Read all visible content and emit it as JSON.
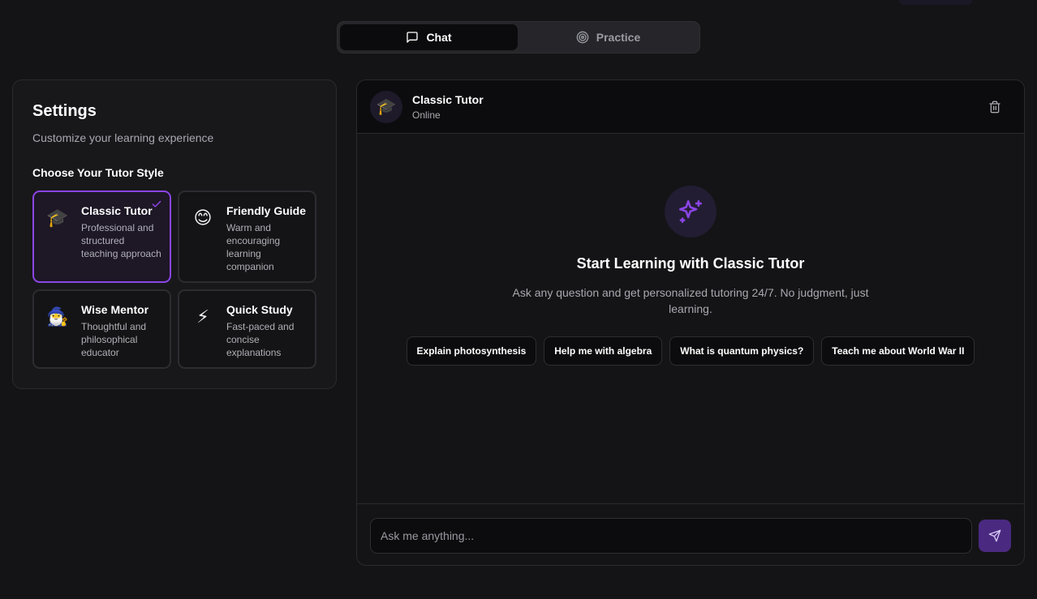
{
  "tabs": [
    {
      "label": "Chat",
      "icon": "message-square-icon",
      "active": true
    },
    {
      "label": "Practice",
      "icon": "target-icon",
      "active": false
    }
  ],
  "settings": {
    "title": "Settings",
    "subtitle": "Customize your learning experience",
    "section_label": "Choose Your Tutor Style",
    "styles": [
      {
        "emoji": "🎓",
        "name": "Classic Tutor",
        "desc": "Professional and structured teaching approach",
        "selected": true
      },
      {
        "emoji": "😊",
        "name": "Friendly Guide",
        "desc": "Warm and encouraging learning companion",
        "selected": false
      },
      {
        "emoji": "🧙‍♂️",
        "name": "Wise Mentor",
        "desc": "Thoughtful and philosophical educator",
        "selected": false
      },
      {
        "emoji": "⚡",
        "name": "Quick Study",
        "desc": "Fast-paced and concise explanations",
        "selected": false
      }
    ]
  },
  "chat": {
    "avatar_emoji": "🎓",
    "title": "Classic Tutor",
    "status": "Online",
    "hero_title": "Start Learning with Classic Tutor",
    "hero_text": "Ask any question and get personalized tutoring 24/7. No judgment, just learning.",
    "suggestions": [
      "Explain photosynthesis",
      "Help me with algebra",
      "What is quantum physics?",
      "Teach me about World War II"
    ],
    "input_placeholder": "Ask me anything...",
    "input_value": ""
  },
  "colors": {
    "accent": "#8b45e6",
    "send_button": "#4a2a80",
    "background": "#141416"
  }
}
